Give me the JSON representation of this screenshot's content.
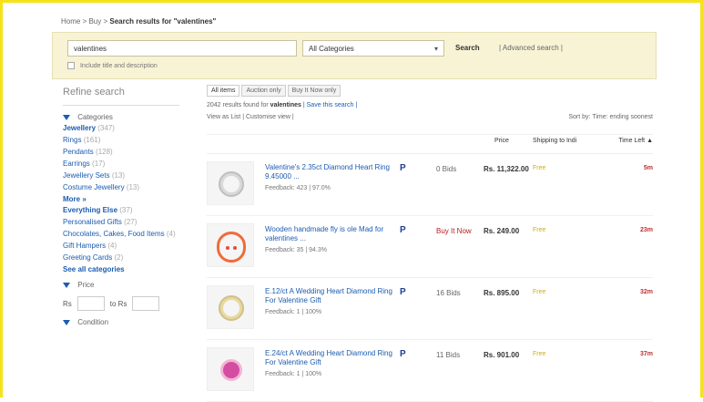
{
  "breadcrumb": {
    "path": "Home > Buy > ",
    "current": "Search results for \"valentines\""
  },
  "search": {
    "value": "valentines",
    "category_selected": "All Categories",
    "search_label": "Search",
    "advanced_label": "| Advanced search |",
    "checkbox_label": "Include title and description"
  },
  "sidebar": {
    "title": "Refine search",
    "categories_title": "Categories",
    "categories": [
      {
        "name": "Jewellery",
        "count": "(347)",
        "bold": true
      },
      {
        "name": "Rings",
        "count": "(161)"
      },
      {
        "name": "Pendants",
        "count": "(128)"
      },
      {
        "name": "Earrings",
        "count": "(17)"
      },
      {
        "name": "Jewellery Sets",
        "count": "(13)"
      },
      {
        "name": "Costume Jewellery",
        "count": "(13)"
      }
    ],
    "more_label": "More »",
    "everything_else": {
      "name": "Everything Else",
      "count": "(37)"
    },
    "everything_subs": [
      {
        "name": "Personalised Gifts",
        "count": "(27)"
      },
      {
        "name": "Chocolates, Cakes, Food Items",
        "count": "(4)"
      },
      {
        "name": "Gift Hampers",
        "count": "(4)"
      },
      {
        "name": "Greeting Cards",
        "count": "(2)"
      }
    ],
    "see_all": "See all categories",
    "price_title": "Price",
    "price_from": "Rs",
    "price_to": "to Rs",
    "condition_title": "Condition"
  },
  "results": {
    "tabs": [
      "All items",
      "Auction only",
      "Buy It Now only"
    ],
    "meta_prefix": "2042 results found for",
    "meta_keyword": "valentines",
    "meta_link": "| Save this search |",
    "view_label": "View as",
    "list_label": "List",
    "customise_label": "| Customise view |",
    "sort_label": "Sort by:",
    "sort_value": "Time: ending soonest",
    "headers": {
      "price": "Price",
      "shipping": "Shipping to Indi",
      "time_left": "Time Left ▲"
    },
    "items": [
      {
        "title": "Valentine's 2.35ct Diamond Heart Ring 9.45000 ...",
        "feedback": "Feedback: 423 | 97.0%",
        "bids": "0 Bids",
        "price": "Rs. 11,322.00",
        "shipping": "Free",
        "time": "5m"
      },
      {
        "title": "Wooden handmade fly is ole Mad for valentines ...",
        "feedback": "Feedback: 35 | 94.3%",
        "bids": "Buy It Now",
        "price": "Rs. 249.00",
        "shipping": "Free",
        "time": "23m",
        "bids_red": true
      },
      {
        "title": "E.12/ct A Wedding Heart Diamond Ring For Valentine Gift",
        "feedback": "Feedback: 1 | 100%",
        "bids": "16 Bids",
        "price": "Rs. 895.00",
        "shipping": "Free",
        "time": "32m"
      },
      {
        "title": "E.24/ct A Wedding Heart Diamond Ring For Valentine Gift",
        "feedback": "Feedback: 1 | 100%",
        "bids": "11 Bids",
        "price": "Rs. 901.00",
        "shipping": "Free",
        "time": "37m"
      }
    ]
  }
}
